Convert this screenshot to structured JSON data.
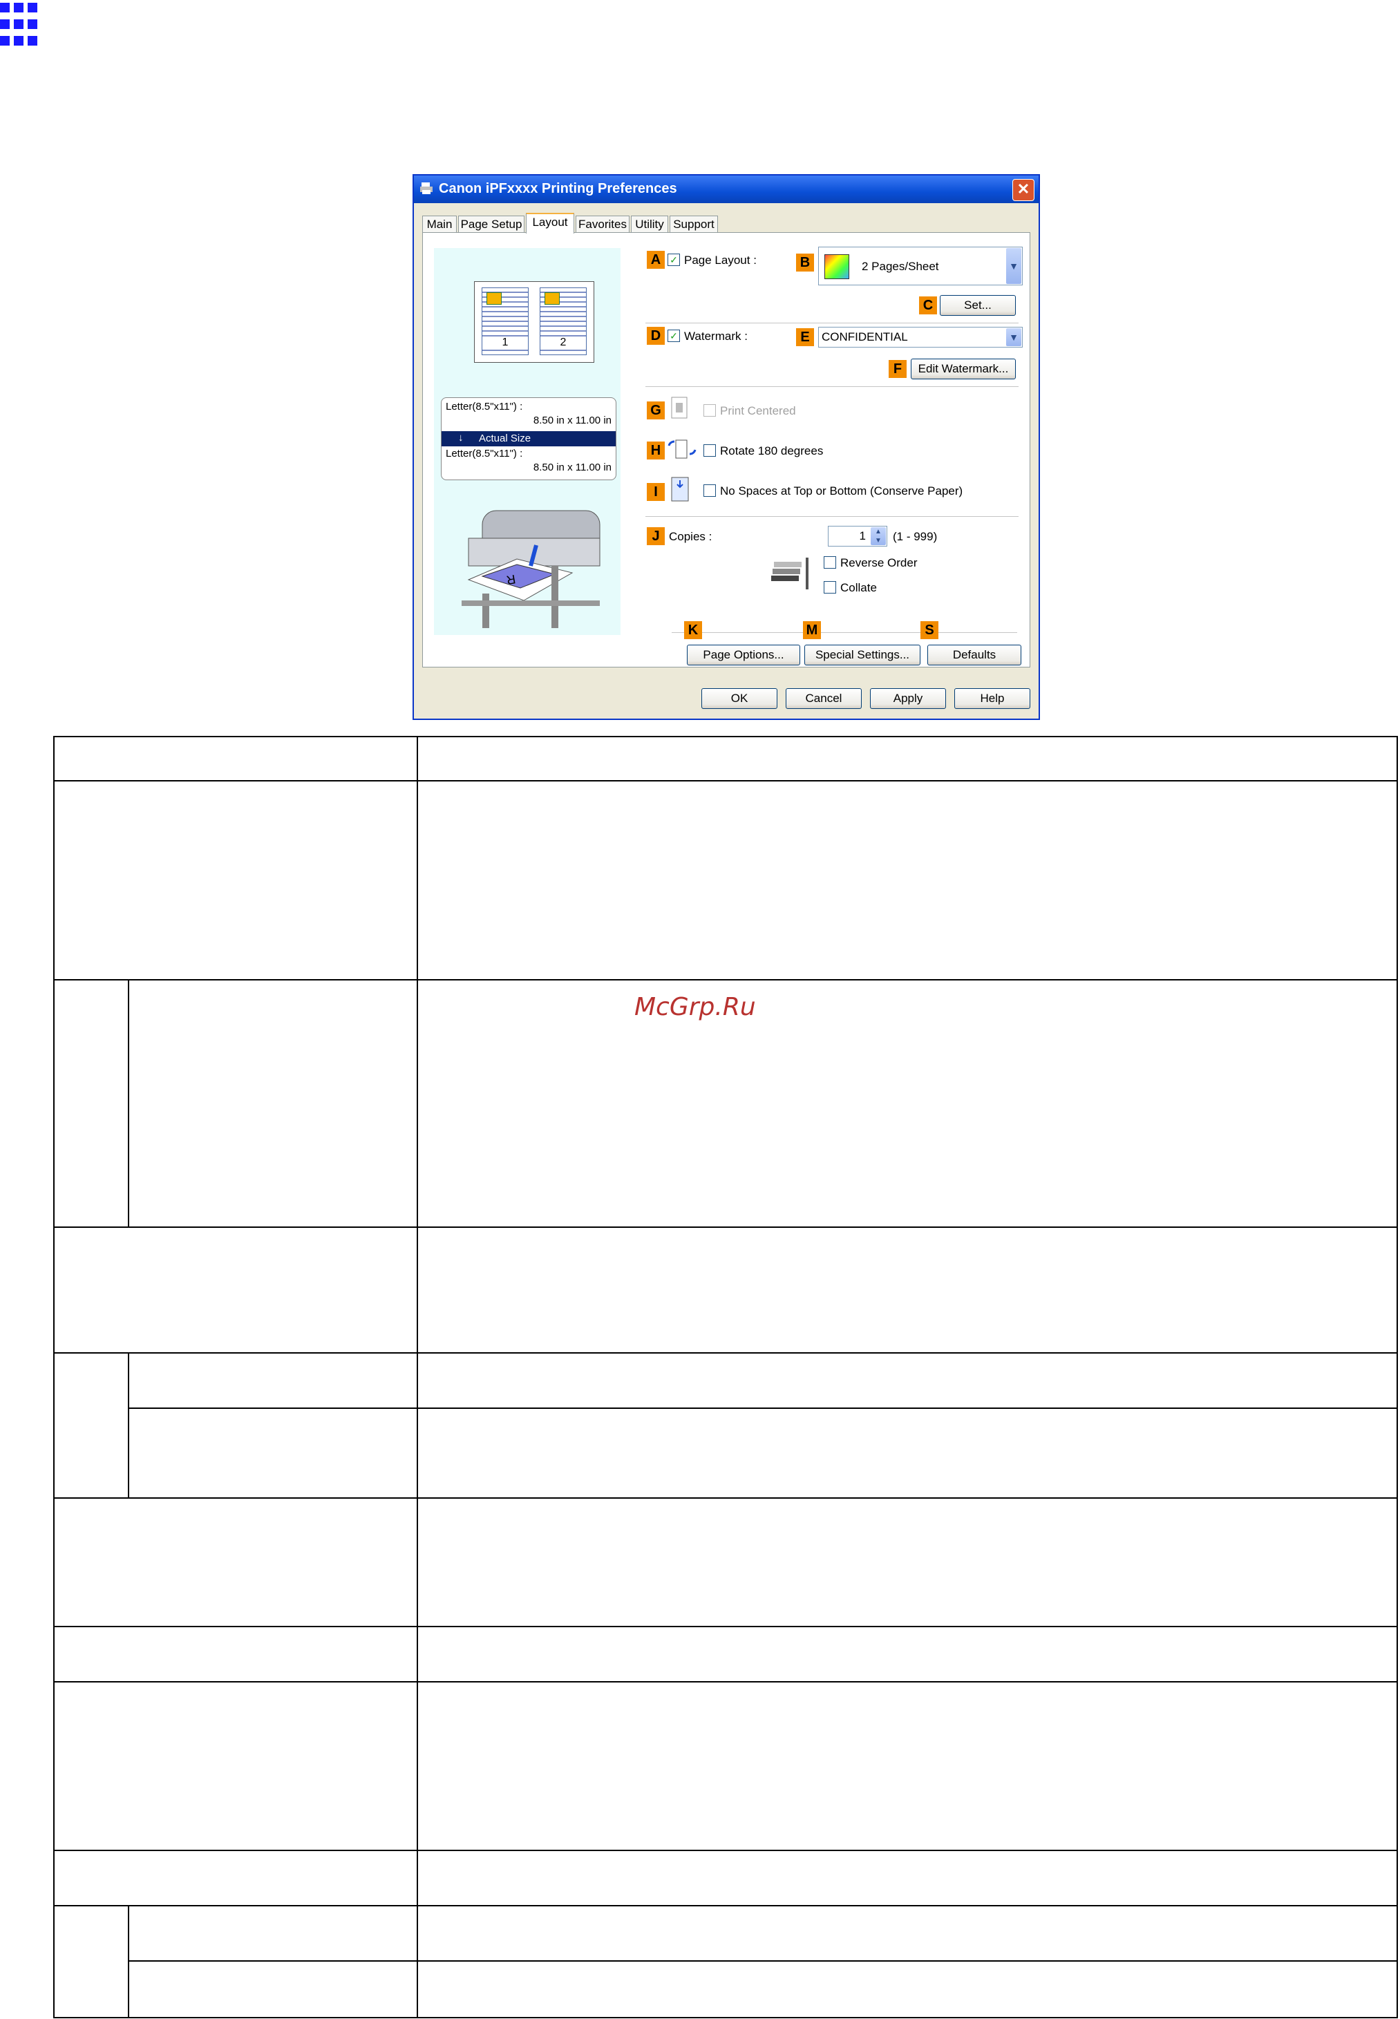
{
  "window": {
    "title": "Canon iPFxxxx Printing Preferences",
    "close_glyph": "✕",
    "accent": "#0a4fd6"
  },
  "tabs": [
    "Main",
    "Page Setup",
    "Layout",
    "Favorites",
    "Utility",
    "Support"
  ],
  "active_tab": "Layout",
  "preview": {
    "page_numbers": [
      "1",
      "2"
    ],
    "original_label": "Letter(8.5\"x11\") :",
    "original_size": "8.50 in x 11.00 in",
    "scaling": "Actual Size",
    "output_label": "Letter(8.5\"x11\") :",
    "output_size": "8.50 in x 11.00 in"
  },
  "markers": {
    "a": "A",
    "b": "B",
    "c": "C",
    "d": "D",
    "e": "E",
    "f": "F",
    "g": "G",
    "h": "H",
    "i": "I",
    "j": "J",
    "k": "K",
    "m": "M",
    "s": "S"
  },
  "controls": {
    "page_layout_label": "Page Layout :",
    "page_layout_checked": true,
    "page_layout_value": "2 Pages/Sheet",
    "set_button": "Set...",
    "watermark_label": "Watermark :",
    "watermark_checked": true,
    "watermark_value": "CONFIDENTIAL",
    "edit_watermark_button": "Edit Watermark...",
    "print_centered_label": "Print Centered",
    "rotate_label": "Rotate 180 degrees",
    "no_spaces_label": "No Spaces at Top or Bottom (Conserve Paper)",
    "copies_label": "Copies :",
    "copies_value": "1",
    "copies_range": "(1 - 999)",
    "reverse_order_label": "Reverse Order",
    "collate_label": "Collate",
    "page_options_button": "Page Options...",
    "special_settings_button": "Special Settings...",
    "defaults_button": "Defaults"
  },
  "footer_buttons": {
    "ok": "OK",
    "cancel": "Cancel",
    "apply": "Apply",
    "help": "Help"
  },
  "watermark_text": "McGrp.Ru"
}
